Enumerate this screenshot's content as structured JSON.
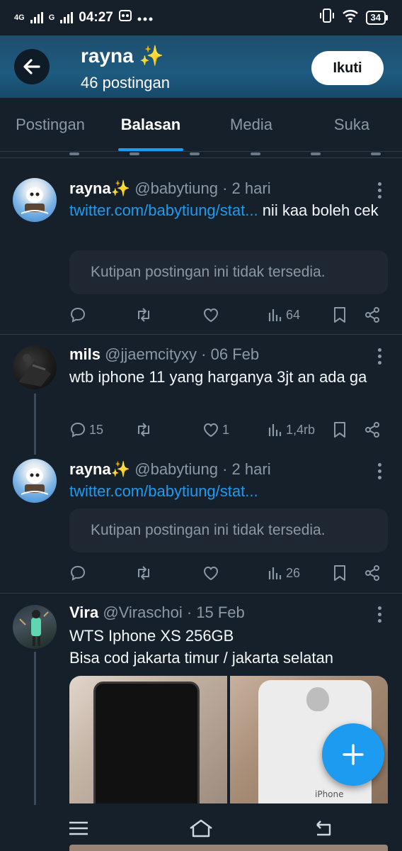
{
  "status_bar": {
    "network_4g": "4G",
    "network_g": "G",
    "time": "04:27",
    "battery": "34"
  },
  "header": {
    "name": "rayna",
    "sparkle": "✨",
    "post_count": "46 postingan",
    "follow_label": "Ikuti"
  },
  "tabs": [
    {
      "label": "Postingan",
      "active": false
    },
    {
      "label": "Balasan",
      "active": true
    },
    {
      "label": "Media",
      "active": false
    },
    {
      "label": "Suka",
      "active": false
    }
  ],
  "posts": [
    {
      "name": "rayna",
      "sparkle": "✨",
      "meta": "@babytiung · 2 hari",
      "link": "twitter.com/babytiung/stat...",
      "text_after_link": " nii kaa boleh cek",
      "quote": "Kutipan postingan ini tidak tersedia.",
      "views": "64"
    },
    {
      "name": "mils",
      "meta": "@jjaemcityxy · 06 Feb",
      "text": "wtb iphone 11 yang harganya 3jt an ada ga",
      "replies": "15",
      "likes": "1",
      "views": "1,4rb"
    },
    {
      "name": "rayna",
      "sparkle": "✨",
      "meta": "@babytiung · 2 hari",
      "link": "twitter.com/babytiung/stat...",
      "quote": "Kutipan postingan ini tidak tersedia.",
      "views": "26"
    },
    {
      "name": "Vira",
      "meta": "@Viraschoi · 15 Feb",
      "text_line1": "WTS Iphone XS 256GB",
      "text_line2": "Bisa cod jakarta timur / jakarta selatan",
      "media_label": "iPhone"
    }
  ],
  "colors": {
    "background": "#15202b",
    "accent": "#1d9bf0",
    "muted": "#8b98a5",
    "header_bg": "#1e5b80"
  }
}
